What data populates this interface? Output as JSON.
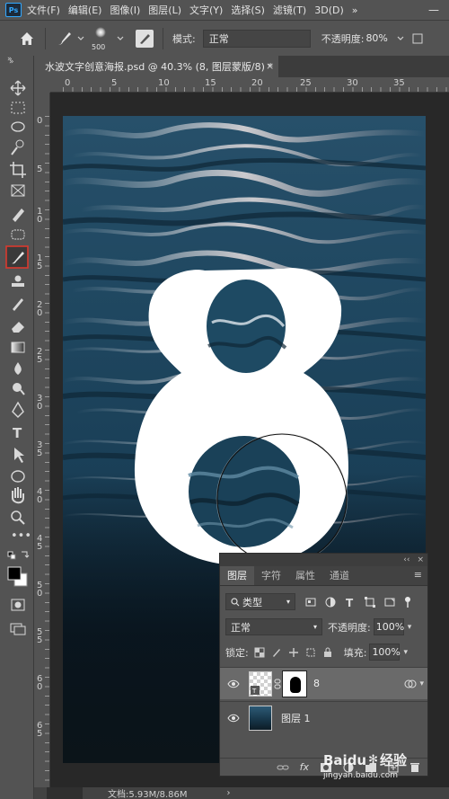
{
  "menubar": {
    "logo": "Ps",
    "items": [
      "文件(F)",
      "编辑(E)",
      "图像(I)",
      "图层(L)",
      "文字(Y)",
      "选择(S)",
      "滤镜(T)",
      "3D(D)"
    ],
    "more": "»",
    "minimize": "—"
  },
  "options": {
    "brush_size": "500",
    "mode_label": "模式:",
    "mode_value": "正常",
    "opacity_label": "不透明度:",
    "opacity_value": "80%"
  },
  "document": {
    "tab_title": "水波文字创意海报.psd @ 40.3% (8, 图层蒙版/8) *",
    "close": "×",
    "collapse": "»"
  },
  "ruler": {
    "h_labels": [
      "0",
      "5",
      "10",
      "15",
      "20",
      "25",
      "30",
      "35"
    ],
    "v_labels": [
      "0",
      "5",
      "1 0",
      "1 5",
      "2 0",
      "2 5",
      "3 0",
      "3 5",
      "4 0",
      "4 5",
      "5 0",
      "5 5",
      "6 0",
      "6 5"
    ]
  },
  "canvas": {
    "big_number": "8"
  },
  "layers_panel": {
    "collapse": "‹‹",
    "close": "×",
    "tabs": [
      "图层",
      "字符",
      "属性",
      "通道"
    ],
    "filter_kind": "类型",
    "blend_mode": "正常",
    "opacity_label": "不透明度:",
    "opacity_value": "100%",
    "lock_label": "锁定:",
    "fill_label": "填充:",
    "fill_value": "100%",
    "layers": [
      {
        "name": "8",
        "selected": true
      },
      {
        "name": "图层 1",
        "selected": false
      }
    ],
    "footer_fx": "fx"
  },
  "status": {
    "doc_info": "文档:5.93M/8.86M",
    "arrow": "›"
  },
  "watermark": {
    "brand": "Baidu",
    "suffix": "经验",
    "url": "jingyan.baidu.com"
  },
  "colors": {
    "accent": "#31a8ff",
    "active_tool_border": "#d9392e",
    "water_dark": "#0b1419",
    "water_mid": "#1f4760"
  }
}
